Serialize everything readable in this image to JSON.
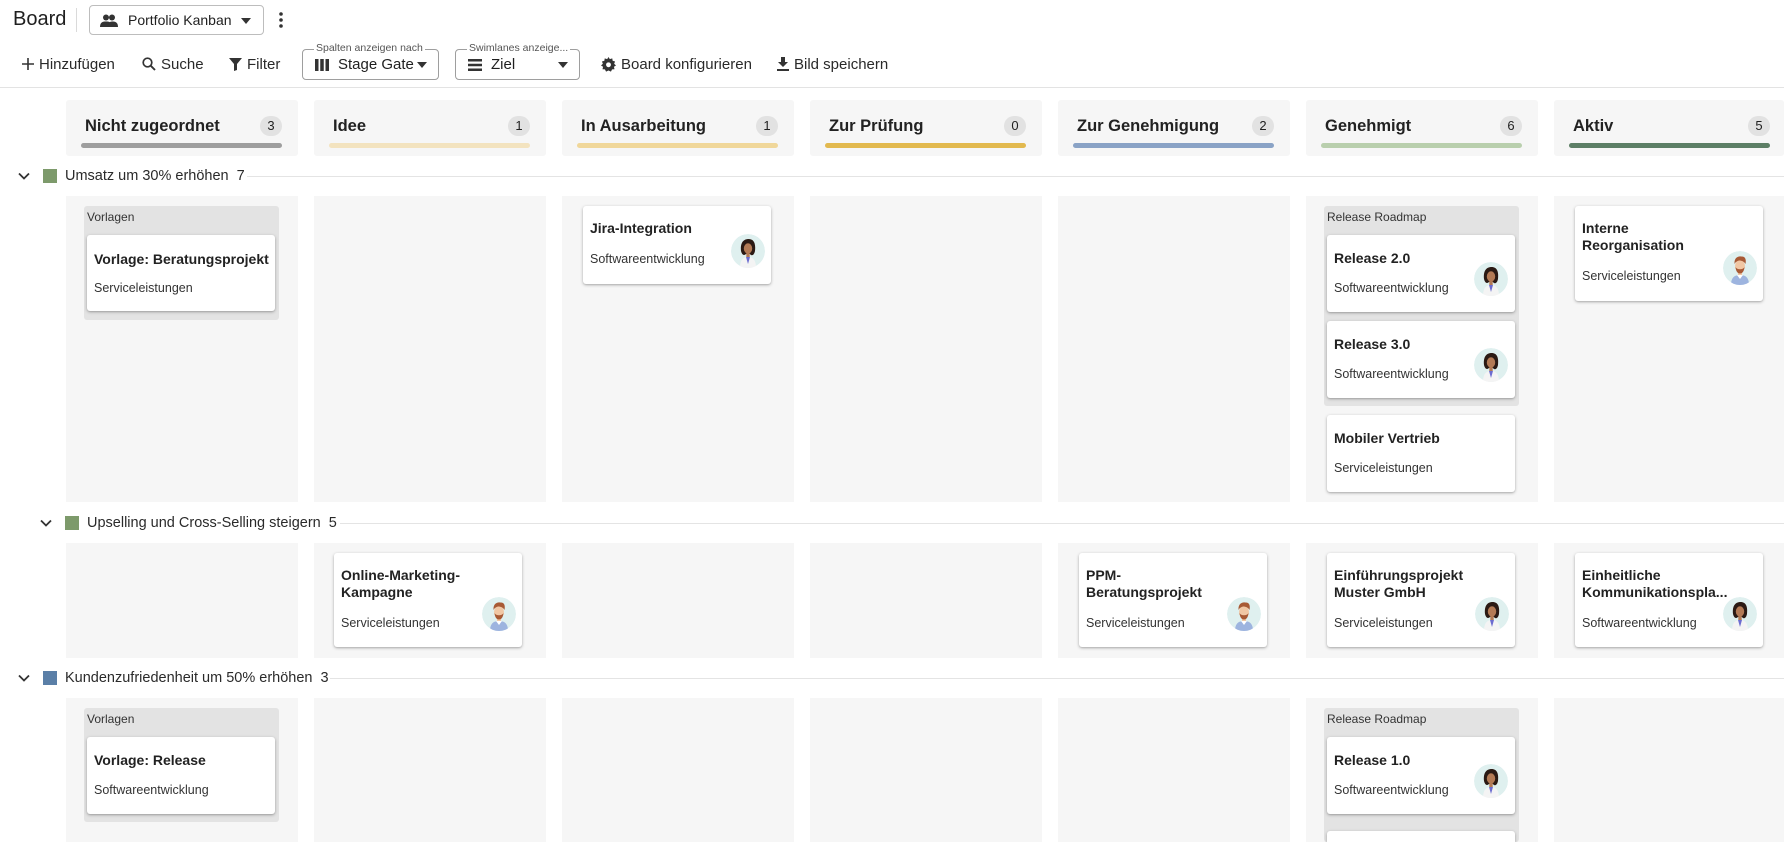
{
  "header": {
    "title": "Board",
    "board_name": "Portfolio Kanban"
  },
  "toolbar": {
    "add": "Hinzufügen",
    "search": "Suche",
    "filter": "Filter",
    "columns_label": "Spalten anzeigen nach",
    "columns_value": "Stage Gate",
    "swimlanes_label": "Swimlanes anzeige...",
    "swimlanes_value": "Ziel",
    "configure": "Board konfigurieren",
    "save_image": "Bild speichern"
  },
  "columns": [
    {
      "name": "Nicht zugeordnet",
      "count": "3",
      "color": "#9e9e9e"
    },
    {
      "name": "Idee",
      "count": "1",
      "color": "#f3e3bf"
    },
    {
      "name": "In Ausarbeitung",
      "count": "1",
      "color": "#f0d79a"
    },
    {
      "name": "Zur Prüfung",
      "count": "0",
      "color": "#e2b94f"
    },
    {
      "name": "Zur Genehmigung",
      "count": "2",
      "color": "#8aa3c6"
    },
    {
      "name": "Genehmigt",
      "count": "6",
      "color": "#b9cfad"
    },
    {
      "name": "Aktiv",
      "count": "5",
      "color": "#5d7f66"
    }
  ],
  "swimlanes": [
    {
      "name": "Umsatz um 30% erhöhen",
      "count": "7",
      "color": "#7d9a6b"
    },
    {
      "name": "Upselling und Cross-Selling steigern",
      "count": "5",
      "color": "#7d9a6b"
    },
    {
      "name": "Kundenzufriedenheit um 50% erhöhen",
      "count": "3",
      "color": "#5a7fa7"
    }
  ],
  "groups": {
    "templates": "Vorlagen",
    "release_roadmap": "Release Roadmap"
  },
  "cards": {
    "vorlage_beratung": {
      "title": "Vorlage: Beratungsprojekt",
      "sub": "Serviceleistungen"
    },
    "jira": {
      "title": "Jira-Integration",
      "sub": "Softwareentwicklung"
    },
    "release20": {
      "title": "Release 2.0",
      "sub": "Softwareentwicklung"
    },
    "release30": {
      "title": "Release 3.0",
      "sub": "Softwareentwicklung"
    },
    "mobiler": {
      "title": "Mobiler Vertrieb",
      "sub": "Serviceleistungen"
    },
    "interne": {
      "title": "Interne Reorganisation",
      "sub": "Serviceleistungen"
    },
    "online": {
      "title": "Online-Marketing-Kampagne",
      "sub": "Serviceleistungen"
    },
    "ppm": {
      "title": "PPM-Beratungsprojekt",
      "sub": "Serviceleistungen"
    },
    "einf": {
      "title": "Einführungsprojekt Muster GmbH",
      "sub": "Serviceleistungen"
    },
    "einh": {
      "title": "Einheitliche Kommunikationspla...",
      "sub": "Softwareentwicklung"
    },
    "vorlage_release": {
      "title": "Vorlage: Release",
      "sub": "Softwareentwicklung"
    },
    "release10": {
      "title": "Release 1.0",
      "sub": "Softwareentwicklung"
    }
  },
  "icons": {
    "board_select": "people-icon",
    "add": "plus-icon",
    "search": "search-icon",
    "filter": "filter-icon",
    "columns": "columns-icon",
    "swimlanes": "rows-icon",
    "configure": "gear-icon",
    "save_image": "download-icon",
    "avatar_woman": "avatar-woman-icon",
    "avatar_man": "avatar-man-icon"
  }
}
